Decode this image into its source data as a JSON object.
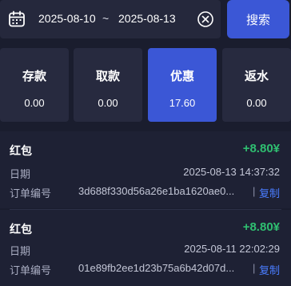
{
  "search_bar": {
    "calendar_icon": "calendar-icon",
    "start_date": "2025-08-10",
    "separator": "~",
    "end_date": "2025-08-13",
    "clear_icon": "close-circle-icon",
    "search_label": "搜索"
  },
  "tabs": [
    {
      "label": "存款",
      "value": "0.00",
      "active": false
    },
    {
      "label": "取款",
      "value": "0.00",
      "active": false
    },
    {
      "label": "优惠",
      "value": "17.60",
      "active": true
    },
    {
      "label": "返水",
      "value": "0.00",
      "active": false
    }
  ],
  "records": [
    {
      "title": "红包",
      "amount": "+8.80¥",
      "date_label": "日期",
      "date": "2025-08-13 14:37:32",
      "order_label": "订单编号",
      "order_no": "3d688f330d56a26e1ba1620ae0...",
      "separator": "|",
      "copy_label": "复制"
    },
    {
      "title": "红包",
      "amount": "+8.80¥",
      "date_label": "日期",
      "date": "2025-08-11 22:02:29",
      "order_label": "订单编号",
      "order_no": "01e89fb2ee1d23b75a6b42d07d...",
      "separator": "|",
      "copy_label": "复制"
    }
  ],
  "colors": {
    "background": "#1a1d2e",
    "accent": "#3b57d6",
    "amount": "#2fbf71",
    "link": "#4a7dff"
  }
}
